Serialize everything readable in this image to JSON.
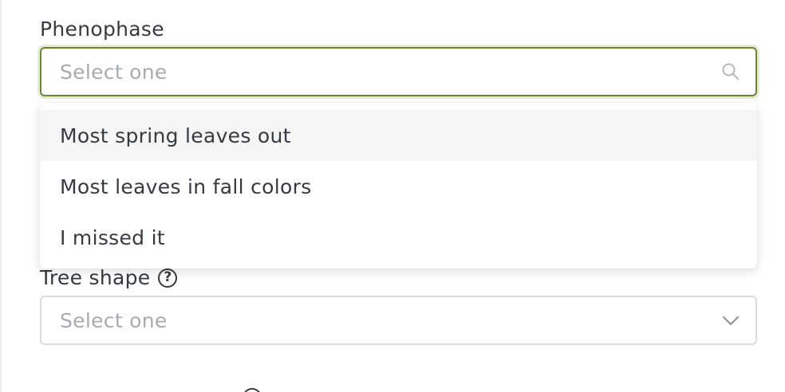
{
  "phenophase": {
    "label": "Phenophase",
    "placeholder": "Select one",
    "icon": "search-icon",
    "options": [
      {
        "label": "Most spring leaves out"
      },
      {
        "label": "Most leaves in fall colors"
      },
      {
        "label": "I missed it"
      }
    ]
  },
  "tree_shape": {
    "label": "Tree shape",
    "help_text": "?",
    "placeholder": "Select one",
    "icon": "chevron-down-icon"
  },
  "colors": {
    "focus_border": "#6c852f",
    "focus_ring": "#e3ebd2",
    "text": "#353b40",
    "placeholder": "#a6acb1",
    "option_hover": "#f5f5f5"
  }
}
